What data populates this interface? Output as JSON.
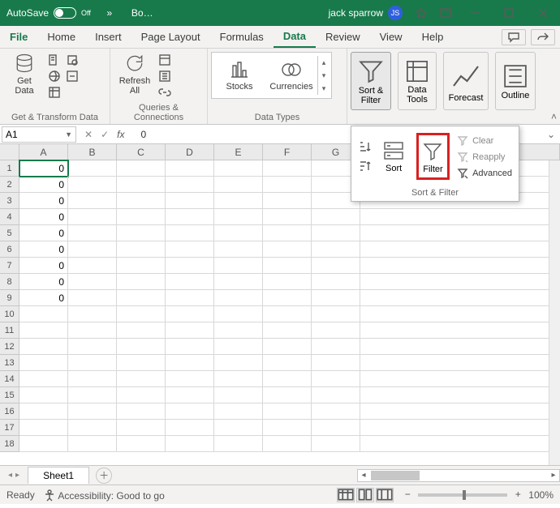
{
  "titlebar": {
    "autosave_label": "AutoSave",
    "autosave_state": "Off",
    "overflow": "»",
    "doc_name": "Bo…",
    "user_name": "jack sparrow",
    "user_initials": "JS"
  },
  "tabs": {
    "file": "File",
    "items": [
      "Home",
      "Insert",
      "Page Layout",
      "Formulas",
      "Data",
      "Review",
      "View",
      "Help"
    ],
    "active": "Data"
  },
  "ribbon": {
    "group_gettransform": {
      "label": "Get & Transform Data",
      "get_data": "Get\nData"
    },
    "group_queries": {
      "label": "Queries & Connections",
      "refresh_all": "Refresh\nAll"
    },
    "group_datatypes": {
      "label": "Data Types",
      "stocks": "Stocks",
      "currencies": "Currencies"
    },
    "group_sortfilter": {
      "sort_filter": "Sort &\nFilter"
    },
    "group_datatools": {
      "data_tools": "Data\nTools"
    },
    "group_forecast": {
      "forecast": "Forecast"
    },
    "group_outline": {
      "outline": "Outline"
    }
  },
  "dropdown": {
    "sort": "Sort",
    "filter": "Filter",
    "clear": "Clear",
    "reapply": "Reapply",
    "advanced": "Advanced",
    "group_label": "Sort & Filter"
  },
  "formula": {
    "name_box": "A1",
    "fx_label": "fx",
    "value": "0"
  },
  "grid": {
    "columns": [
      "A",
      "B",
      "C",
      "D",
      "E",
      "F",
      "G"
    ],
    "row_headers": [
      "1",
      "2",
      "3",
      "4",
      "5",
      "6",
      "7",
      "8",
      "9",
      "10",
      "11",
      "12",
      "13",
      "14",
      "15",
      "16",
      "17",
      "18"
    ],
    "colA": {
      "1": "0",
      "2": "0",
      "3": "0",
      "4": "0",
      "5": "0",
      "6": "0",
      "7": "0",
      "8": "0",
      "9": "0"
    },
    "selected": "A1"
  },
  "sheets": {
    "active": "Sheet1"
  },
  "statusbar": {
    "ready": "Ready",
    "accessibility": "Accessibility: Good to go",
    "zoom": "100%"
  }
}
